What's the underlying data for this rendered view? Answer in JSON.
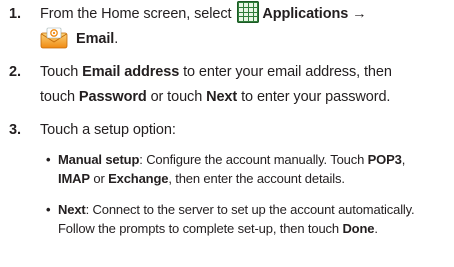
{
  "steps": [
    {
      "number": "1.",
      "line1_prefix": "From the Home screen, select",
      "apps_label": "Applications",
      "arrow": "→",
      "email_label": "Email",
      "period": ".",
      "icons": [
        "applications-grid-icon",
        "email-envelope-icon"
      ]
    },
    {
      "number": "2.",
      "touch": "Touch",
      "email_address": "Email address",
      "mid1": "to enter your email address, then",
      "touch2": "touch",
      "password": "Password",
      "or_touch": "or touch",
      "next": "Next",
      "end": "to enter your password."
    },
    {
      "number": "3.",
      "text": "Touch a setup option:",
      "options": [
        {
          "bullet": "•",
          "name": "Manual setup",
          "colon_text": ": Configure the account manually. Touch",
          "pop3": "POP3",
          "comma": ",",
          "imap": "IMAP",
          "or": "or",
          "exchange": "Exchange",
          "rest": ", then enter the account details."
        },
        {
          "bullet": "•",
          "name": "Next",
          "colon_text": ": Connect to the server to set up the account automatically.",
          "line2_prefix": "Follow the prompts to complete set-up, then touch",
          "done": "Done",
          "period": "."
        }
      ]
    }
  ],
  "colors": {
    "text": "#231f20",
    "apps_icon_green": "#2f7d3a",
    "email_icon_orange": "#f5a623"
  }
}
